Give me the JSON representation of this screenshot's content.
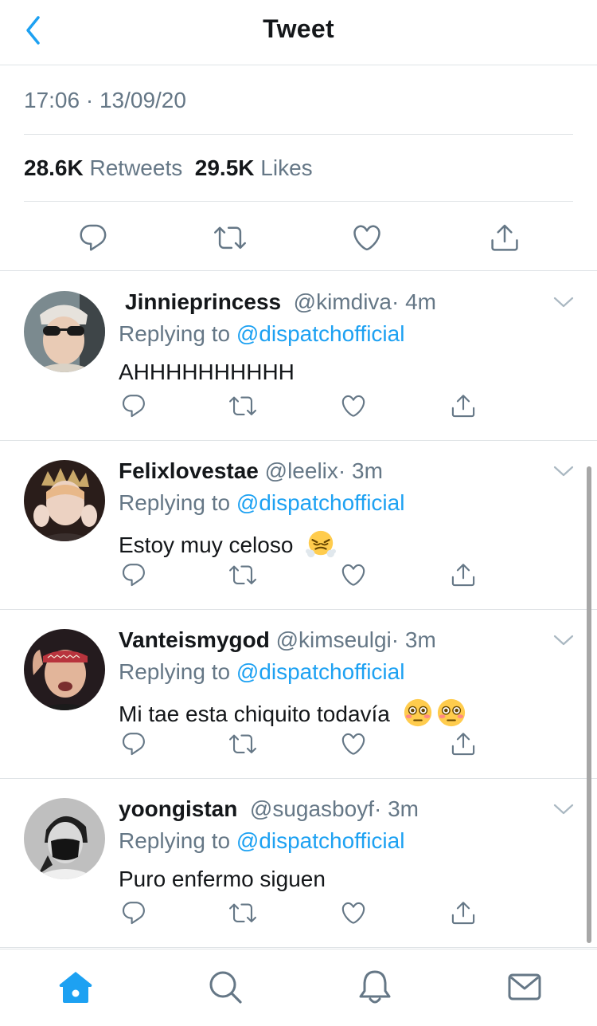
{
  "header": {
    "title": "Tweet",
    "back_icon": "chevron-left-icon"
  },
  "tweet": {
    "timestamp": "17:06 · 13/09/20",
    "retweets_count": "28.6K",
    "retweets_label": "Retweets",
    "likes_count": "29.5K",
    "likes_label": "Likes"
  },
  "replies": [
    {
      "name": "Jinnieprincess",
      "handle": "@kimdiva",
      "time": "· 4m",
      "replying_label": "Replying to",
      "mention": "@dispatchofficial",
      "text": "AHHHHHHHHHH"
    },
    {
      "name": "Felixlovestae",
      "handle": "@leelix",
      "time": "· 3m",
      "replying_label": "Replying to",
      "mention": "@dispatchofficial",
      "text": "Estoy muy celoso",
      "emoji": [
        "face-with-steam-from-nose"
      ]
    },
    {
      "name": "Vanteismygod",
      "handle": "@kimseulgi",
      "time": "· 3m",
      "replying_label": "Replying to",
      "mention": "@dispatchofficial",
      "text": "Mi tae esta chiquito todavía",
      "emoji": [
        "flushed-face",
        "flushed-face"
      ]
    },
    {
      "name": "yoongistan",
      "handle": "@sugasboyf",
      "time": "· 3m",
      "replying_label": "Replying to",
      "mention": "@dispatchofficial",
      "text": "Puro enfermo siguen"
    }
  ],
  "tabbar": [
    "home-icon",
    "search-icon",
    "notifications-icon",
    "messages-icon"
  ],
  "colors": {
    "accent": "#1da1f2",
    "secondary_text": "#657786",
    "divider": "#dfe3e6",
    "icon_gray": "#657786"
  }
}
